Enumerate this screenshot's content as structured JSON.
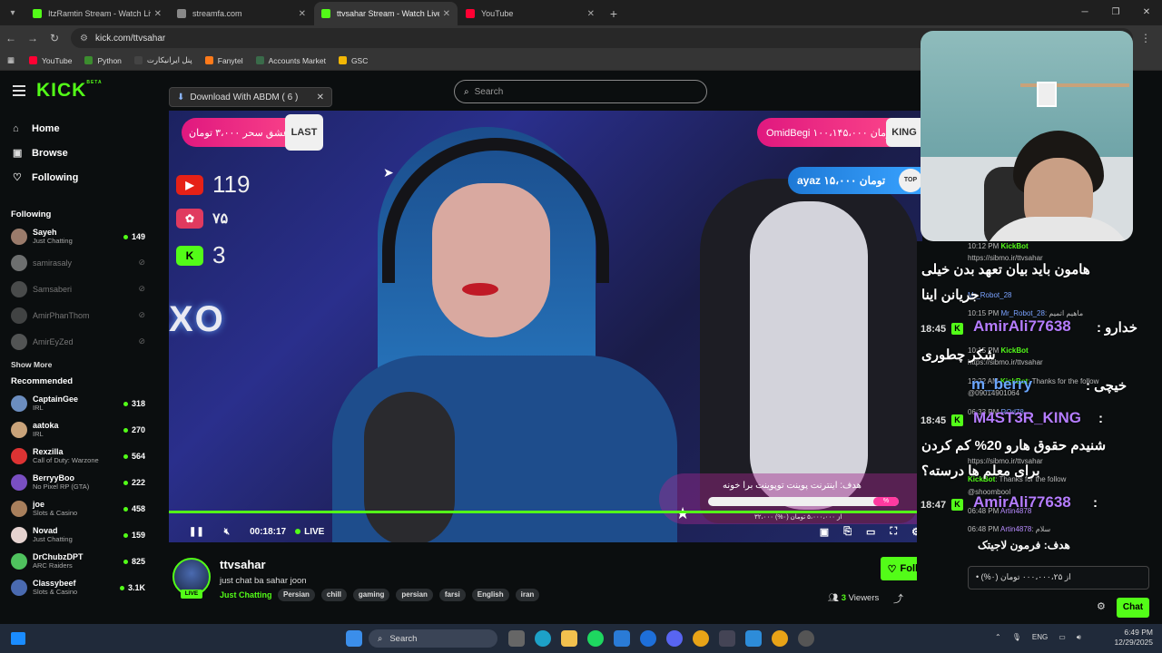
{
  "browser": {
    "tabs": [
      {
        "title": "ItzRamtin Stream - Watch Live o",
        "color": "#53fc18",
        "active": false
      },
      {
        "title": "streamfa.com",
        "color": "#888888",
        "active": false
      },
      {
        "title": "ttvsahar Stream - Watch Live o",
        "color": "#53fc18",
        "active": true
      },
      {
        "title": "YouTube",
        "color": "#ff0033",
        "active": false
      }
    ],
    "url": "kick.com/ttvsahar",
    "bookmarks": [
      {
        "label": "YouTube",
        "color": "#ff0033"
      },
      {
        "label": "Python",
        "color": "#3c8d2f"
      },
      {
        "label": "پنل ایرانیکارت",
        "color": "#444"
      },
      {
        "label": "Fanytel",
        "color": "#ff7a1a"
      },
      {
        "label": "Accounts Market",
        "color": "#3a6b4a"
      },
      {
        "label": "GSC",
        "color": "#f2b705"
      }
    ]
  },
  "header": {
    "logo": "KICK",
    "logo_sup": "BETA",
    "search_placeholder": "Search",
    "abdm_label": "Download With ABDM ( 6 )"
  },
  "sidebar": {
    "nav": [
      {
        "label": "Home",
        "icon": "home-icon"
      },
      {
        "label": "Browse",
        "icon": "browse-icon"
      },
      {
        "label": "Following",
        "icon": "heart-icon"
      }
    ],
    "following_title": "Following",
    "following": [
      {
        "name": "Sayeh",
        "category": "Just Chatting",
        "viewers": "149",
        "online": true,
        "color": "#9a7b6b"
      },
      {
        "name": "samirasaly",
        "category": "",
        "viewers": "",
        "online": false,
        "color": "#cfcfcf"
      },
      {
        "name": "Samsaberi",
        "category": "",
        "viewers": "",
        "online": false,
        "color": "#888"
      },
      {
        "name": "AmirPhanThom",
        "category": "",
        "viewers": "",
        "online": false,
        "color": "#777"
      },
      {
        "name": "AmirEyZed",
        "category": "",
        "viewers": "",
        "online": false,
        "color": "#999"
      }
    ],
    "show_more": "Show More",
    "recommended_title": "Recommended",
    "recommended": [
      {
        "name": "CaptainGee",
        "category": "IRL",
        "viewers": "318",
        "color": "#6b8dbf"
      },
      {
        "name": "aatoka",
        "category": "IRL",
        "viewers": "270",
        "color": "#c9a37a"
      },
      {
        "name": "Rexzilla",
        "category": "Call of Duty: Warzone",
        "viewers": "564",
        "color": "#d33"
      },
      {
        "name": "BerryyBoo",
        "category": "No Pixel RP (GTA)",
        "viewers": "222",
        "color": "#7a4fc2"
      },
      {
        "name": "joe",
        "category": "Slots & Casino",
        "viewers": "458",
        "color": "#a87f5c"
      },
      {
        "name": "Novad",
        "category": "Just Chatting",
        "viewers": "159",
        "color": "#e5d3d0"
      },
      {
        "name": "DrChubzDPT",
        "category": "ARC Raiders",
        "viewers": "825",
        "color": "#4fc25e"
      },
      {
        "name": "Classybeef",
        "category": "Slots & Casino",
        "viewers": "3.1K",
        "color": "#4a6ab0"
      }
    ]
  },
  "video": {
    "last_donation": "عشق سحر ۳،۰۰۰ تومان",
    "last_label": "LAST",
    "king_donation": "OmidBegi ۱۰۰،۱۴۵،۰۰۰ تومان",
    "king_label": "KING",
    "top_donation": "ayaz ۱۵،۰۰۰ تومان",
    "top_label": "TOP",
    "youtube_count": "119",
    "second_count": "۷۵",
    "kick_count": "3",
    "goal_title": "هدف: اینترنت پوینت توپوینت برا خونه",
    "goal_percent": "%",
    "goal_sub": "۳۲،۰۰۰ از ۵،۰۰۰،۰۰۰ تومان (۰%)",
    "elapsed": "00:18:17",
    "live_label": "LIVE"
  },
  "stream": {
    "name": "ttvsahar",
    "title": "just chat ba sahar joon",
    "category": "Just Chatting",
    "tags": [
      "Persian",
      "chill",
      "gaming",
      "persian",
      "farsi",
      "English",
      "iran"
    ],
    "viewers_count": "3",
    "viewers_label": "Viewers",
    "live": "LIVE",
    "follow": "Follow"
  },
  "chat": {
    "small": [
      {
        "time": "10:12 PM",
        "user": "KickBot",
        "text": ""
      },
      {
        "time": "",
        "user": "",
        "text": "https://sibmo.ir/ttvsahar"
      },
      {
        "time": "10:15 PM",
        "user": "Mr_Robot_28",
        "text": ""
      },
      {
        "time": "10:15 PM",
        "user": "Mr_Robot_28",
        "text": "ماهیم اتمیم"
      },
      {
        "time": "10:15 PM",
        "user": "KickBot",
        "text": ""
      },
      {
        "time": "",
        "user": "",
        "text": "https://sibmo.ir/ttvsahar"
      },
      {
        "time": "12:22 AM",
        "user": "KickBot",
        "text": "Thanks for the follow"
      },
      {
        "time": "",
        "user": "",
        "text": "@09014901064"
      },
      {
        "time": "06:33 PM",
        "user": "ROd78",
        "text": ""
      },
      {
        "time": "",
        "user": "",
        "text": "https://sibmo.ir/ttvsahar"
      },
      {
        "time": "",
        "user": "KickBot",
        "text": "Thanks for the follow"
      },
      {
        "time": "",
        "user": "",
        "text": "@shoombool"
      },
      {
        "time": "06:48 PM",
        "user": "Artin4878",
        "text": ""
      },
      {
        "time": "06:48 PM",
        "user": "Artin4878",
        "text": "سلام"
      }
    ],
    "big": [
      {
        "text": "هامون باید بیان تعهد بدن خیلی"
      },
      {
        "text": "جریانن اینا"
      },
      {
        "time": "18:45",
        "user": "AmirAli77638",
        "text": "خدارو"
      },
      {
        "text": "شکر چطوری"
      },
      {
        "user": "m_berry",
        "text": "خیچی"
      },
      {
        "time": "18:45",
        "user": "M4ST3R_KING",
        "text": ""
      },
      {
        "text": "شنیدم حقوق هارو 20% کم کردن"
      },
      {
        "text": "برای معلم ها درسته؟"
      },
      {
        "time": "18:47",
        "user": "AmirAli77638",
        "text": ""
      }
    ],
    "goal": "هدف: فرمون لاجیتک",
    "input_text": "• از ۰۰۰،۰۰۰،۲۵ تومان (۰%)",
    "send": "Chat"
  },
  "taskbar": {
    "search": "Search",
    "lang": "ENG",
    "time": "6:49 PM",
    "date": "12/29/2025"
  }
}
